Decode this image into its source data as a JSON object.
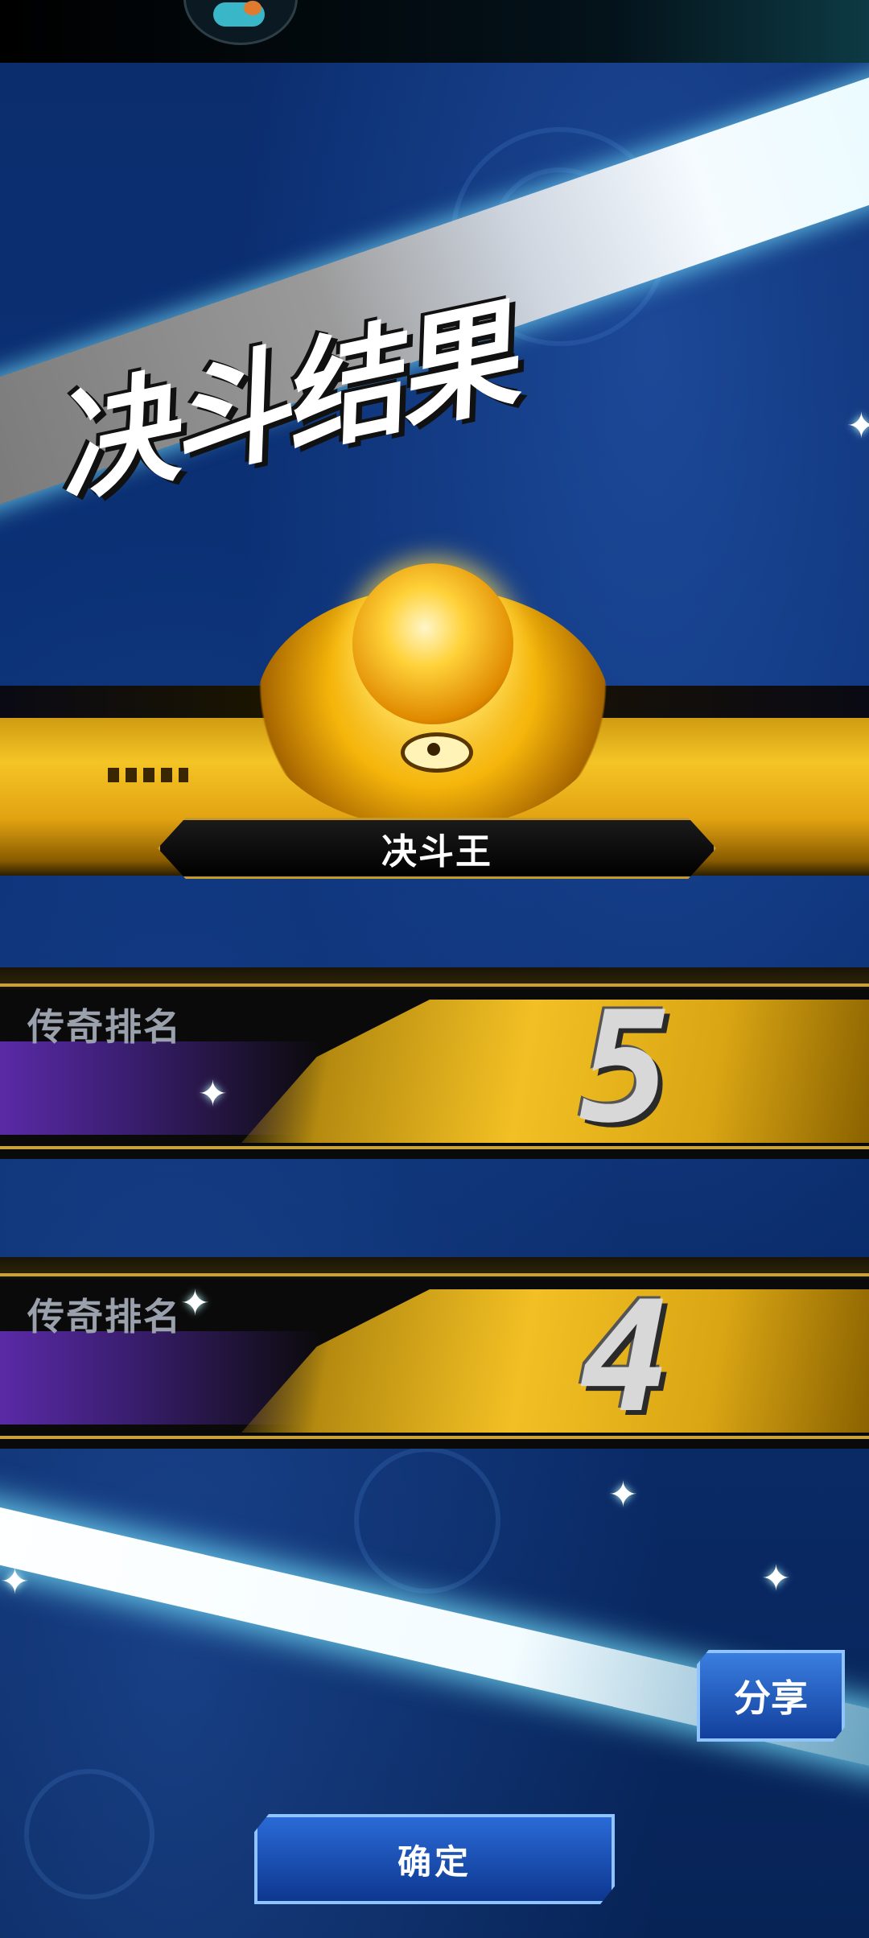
{
  "screen": {
    "title": "决斗结果",
    "rank_title": "决斗王"
  },
  "legend_rankings": [
    {
      "label": "传奇排名",
      "value": "5"
    },
    {
      "label": "传奇排名",
      "value": "4"
    }
  ],
  "buttons": {
    "share": "分享",
    "confirm": "确定"
  },
  "icons": {
    "avatar": "player-avatar-icon",
    "emblem": "king-of-games-emblem-icon",
    "sparkle": "sparkle-icon"
  },
  "colors": {
    "gold": "#f4c426",
    "blue_button": "#2a6ad6",
    "background": "#0b2d6e"
  }
}
